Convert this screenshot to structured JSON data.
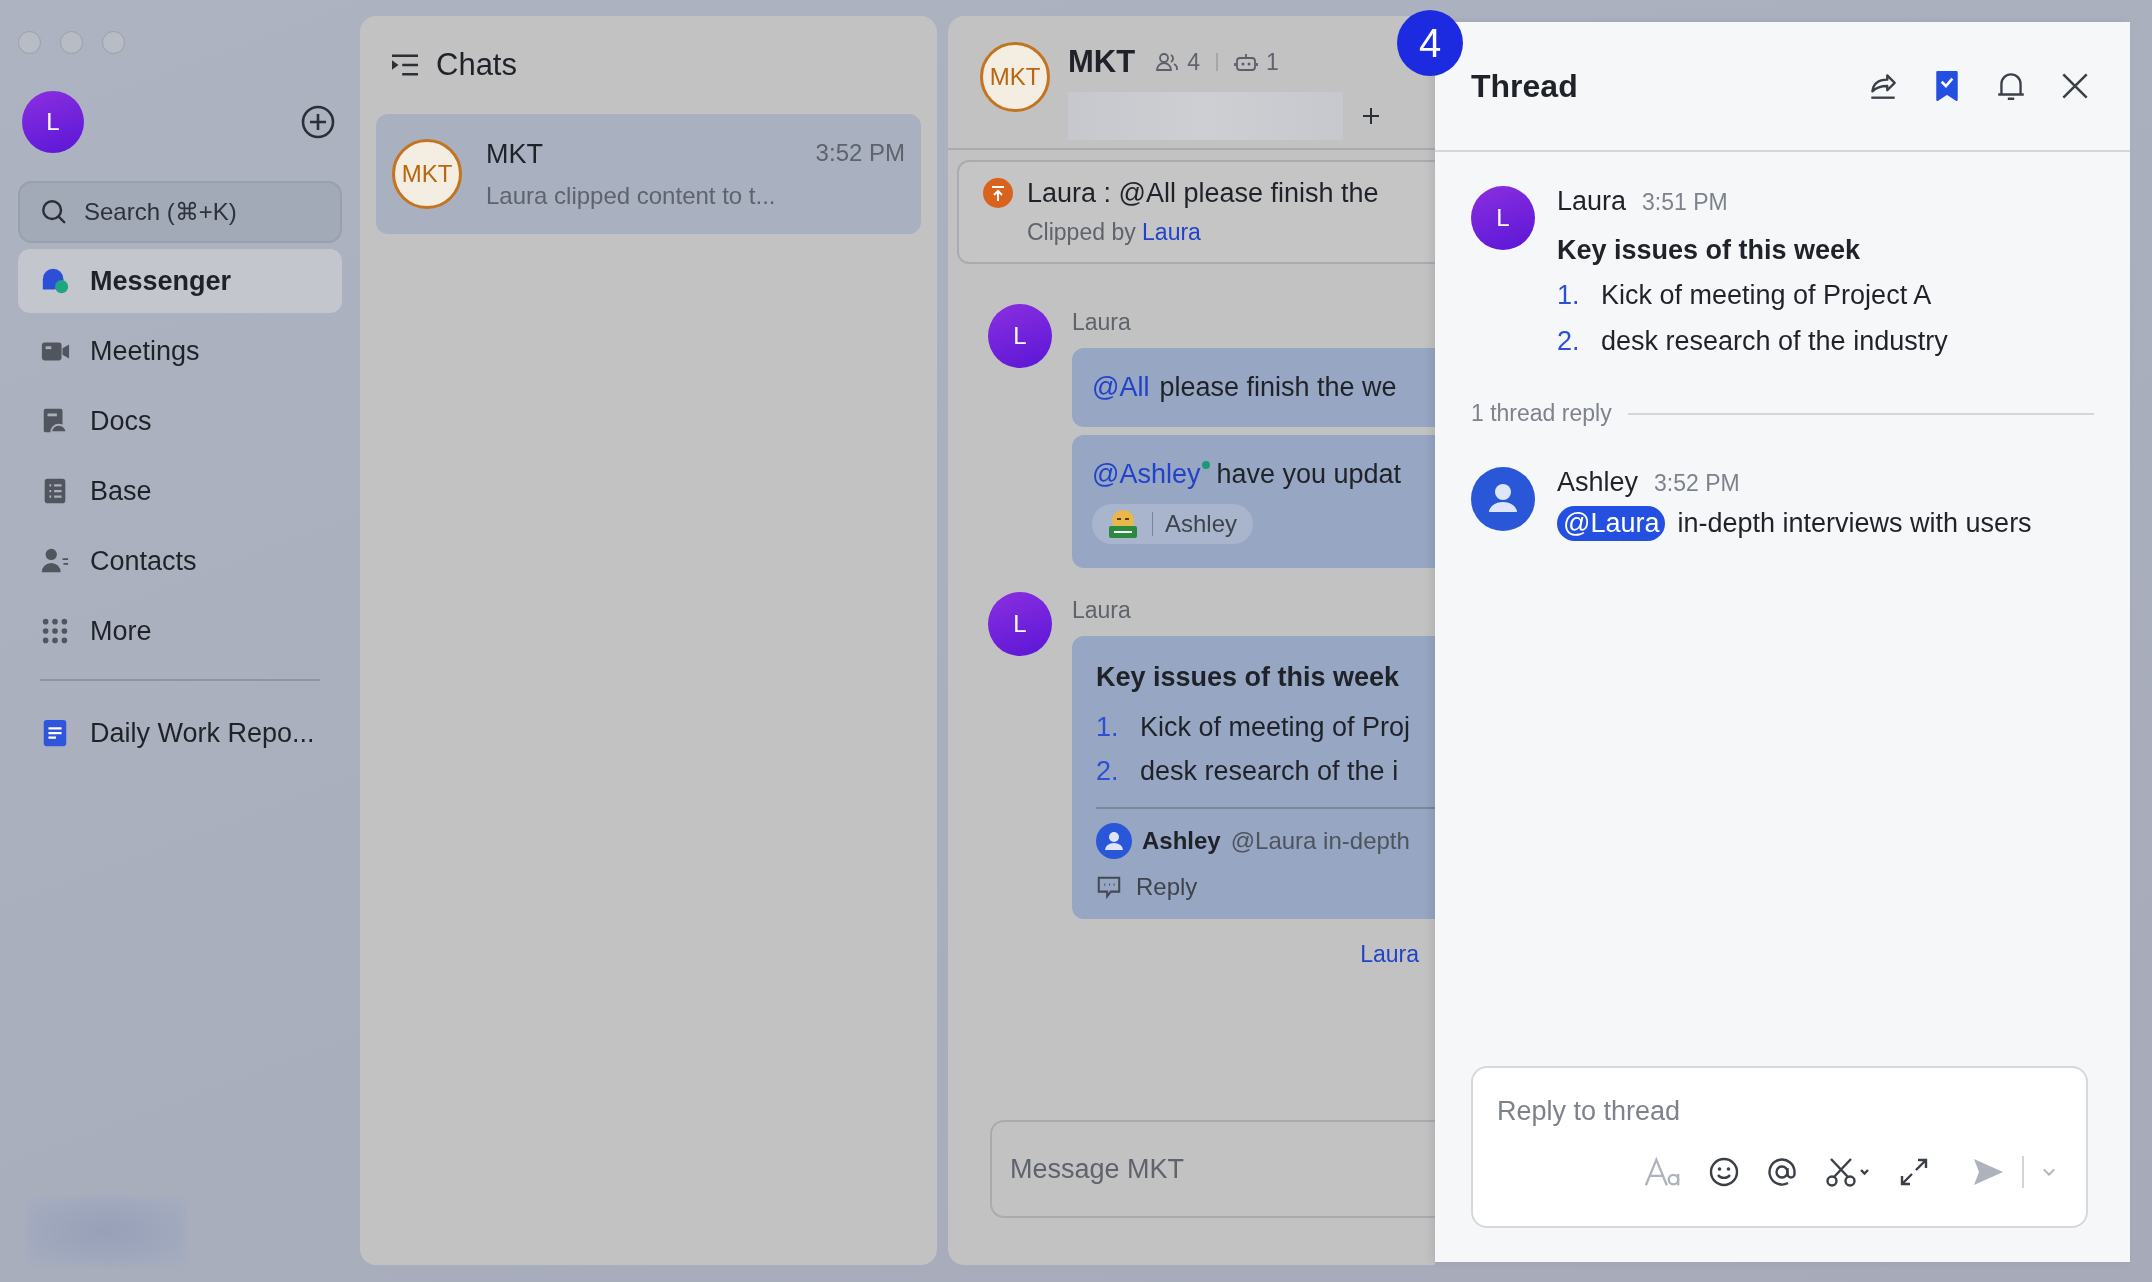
{
  "step_badge": "4",
  "sidebar": {
    "avatar": "L",
    "search": {
      "placeholder": "Search (⌘+K)"
    },
    "items": [
      {
        "kind": "messenger",
        "label": "Messenger",
        "selected": true
      },
      {
        "kind": "meetings",
        "label": "Meetings",
        "selected": false
      },
      {
        "kind": "docs",
        "label": "Docs",
        "selected": false
      },
      {
        "kind": "base",
        "label": "Base",
        "selected": false
      },
      {
        "kind": "contacts",
        "label": "Contacts",
        "selected": false
      },
      {
        "kind": "more",
        "label": "More",
        "selected": false
      }
    ],
    "pinned": [
      {
        "kind": "doc",
        "label": "Daily Work Repo...",
        "selected": false
      }
    ]
  },
  "chats": {
    "title": "Chats",
    "items": [
      {
        "avatar": "MKT",
        "name": "MKT",
        "time": "3:52 PM",
        "preview": "Laura clipped content to t...",
        "selected": true
      }
    ]
  },
  "chat": {
    "avatar": "MKT",
    "name": "MKT",
    "members": "4",
    "bots": "1",
    "pinned": {
      "text": "Laura : @All please finish the",
      "clipped_by_label": "Clipped by",
      "clipped_by": "Laura"
    },
    "messages": [
      {
        "sender": "Laura",
        "avatar": "L",
        "bubbles": [
          {
            "kind": "text",
            "mention": "@All",
            "online": false,
            "text": "please finish the we"
          },
          {
            "kind": "text",
            "mention": "@Ashley",
            "online": true,
            "text": "have you updat",
            "reaction": {
              "name": "Ashley"
            }
          }
        ]
      },
      {
        "sender": "Laura",
        "avatar": "L",
        "bubbles": [
          {
            "kind": "post",
            "title": "Key issues of this week",
            "items": [
              {
                "number": "1.",
                "text": "Kick of meeting of Proj"
              },
              {
                "number": "2.",
                "text": "desk research of the i"
              }
            ],
            "reply_preview": {
              "name": "Ashley",
              "text": "@Laura in-depth"
            },
            "reply_label": "Reply"
          }
        ]
      }
    ],
    "read_by": "Laura",
    "input": {
      "placeholder": "Message MKT"
    }
  },
  "thread": {
    "title": "Thread",
    "bookmarked": true,
    "root": {
      "avatar": "L",
      "sender": "Laura",
      "time": "3:51 PM",
      "title": "Key issues of this week",
      "items": [
        {
          "number": "1.",
          "text": "Kick of meeting of Project A"
        },
        {
          "number": "2.",
          "text": "desk research of the industry"
        }
      ]
    },
    "reply_count": "1 thread reply",
    "replies": [
      {
        "sender": "Ashley",
        "time": "3:52 PM",
        "mention": "@Laura",
        "text": "in-depth interviews with users"
      }
    ],
    "input": {
      "placeholder": "Reply to thread"
    }
  }
}
